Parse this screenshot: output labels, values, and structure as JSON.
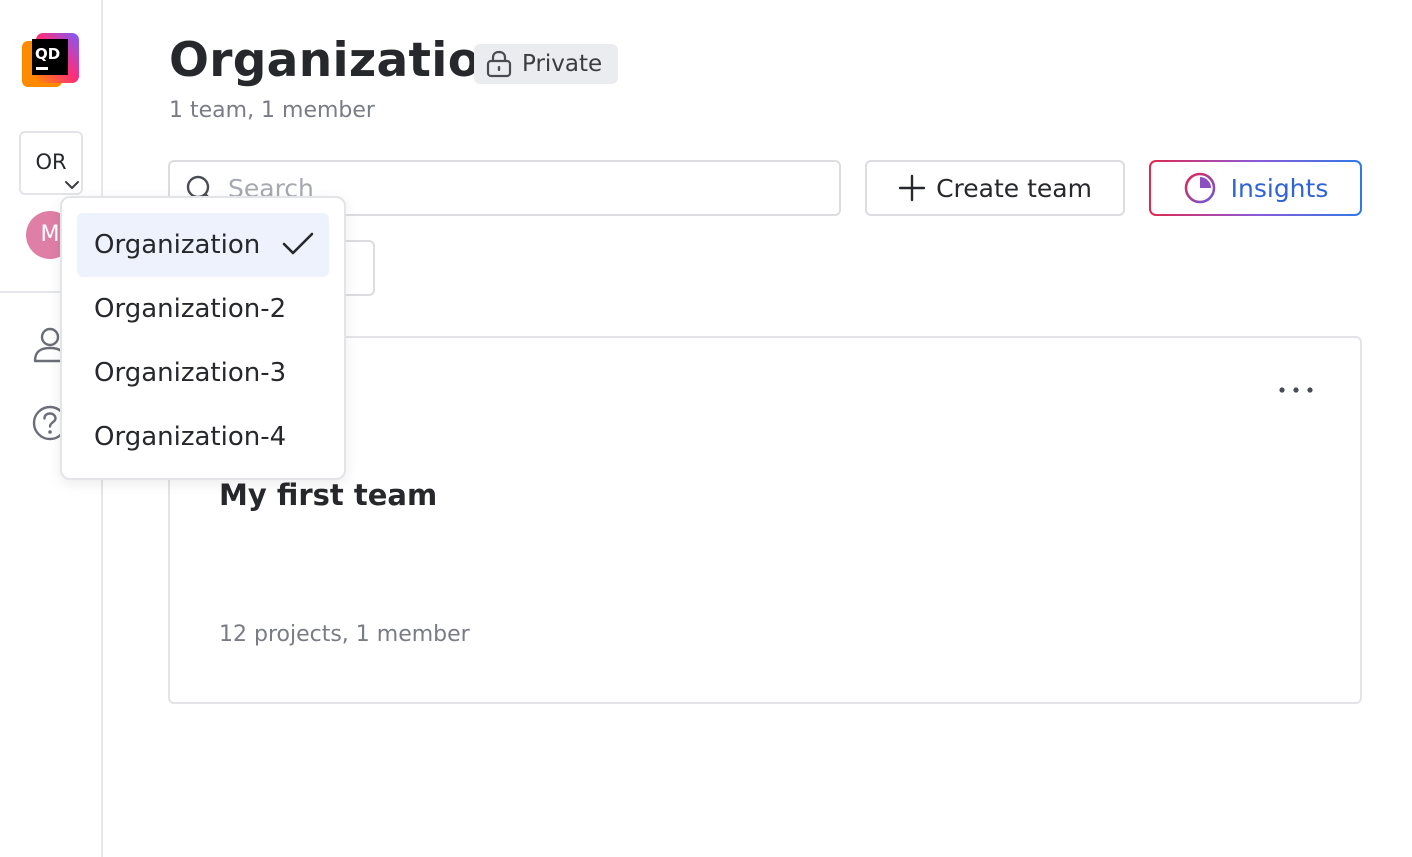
{
  "app": {
    "logo_text": "QD",
    "colors": {
      "accent": "#2f63d6",
      "insights_gradient": [
        "#e0284f",
        "#8b5ad8",
        "#2f7ae6"
      ],
      "avatar_bg": "#e07fa6",
      "selected_bg": "#edf2fd"
    }
  },
  "sidebar": {
    "org_abbr": "OR",
    "avatar_initial": "M",
    "icons": [
      "user-icon",
      "help-icon"
    ]
  },
  "header": {
    "title": "Organization",
    "badge": "Private",
    "subtitle": "1 team, 1 member"
  },
  "toolbar": {
    "search_placeholder": "Search",
    "create_team_label": "Create team",
    "insights_label": "Insights"
  },
  "teams": [
    {
      "name": "My first team",
      "meta": "12 projects, 1 member"
    }
  ],
  "org_menu": {
    "items": [
      {
        "label": "Organization",
        "selected": true
      },
      {
        "label": "Organization-2",
        "selected": false
      },
      {
        "label": "Organization-3",
        "selected": false
      },
      {
        "label": "Organization-4",
        "selected": false
      }
    ]
  }
}
